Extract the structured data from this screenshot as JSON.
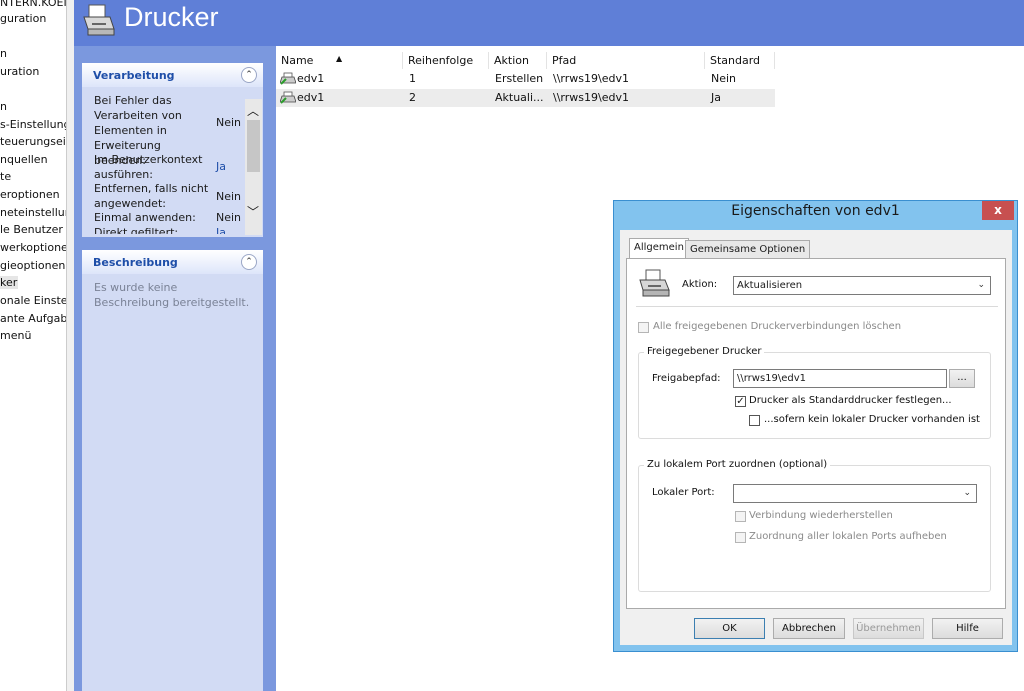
{
  "tree": {
    "items": [
      {
        "label": "NTERN.KOEN"
      },
      {
        "label": "guration"
      },
      {
        "label": "n"
      },
      {
        "label": "uration"
      },
      {
        "label": "n"
      },
      {
        "label": "s-Einstellung"
      },
      {
        "label": "teuerungseir"
      },
      {
        "label": "nquellen"
      },
      {
        "label": "te"
      },
      {
        "label": "eroptionen"
      },
      {
        "label": "neteinstellur"
      },
      {
        "label": "le Benutzer u"
      },
      {
        "label": "werkoptione"
      },
      {
        "label": "gieoptionen"
      },
      {
        "label": "ker"
      },
      {
        "label": "onale Einstel"
      },
      {
        "label": "ante Aufgab"
      },
      {
        "label": "menü"
      }
    ]
  },
  "header": {
    "title": "Drucker",
    "icon": "printer-icon"
  },
  "panels": {
    "verarbeitung": {
      "title": "Verarbeitung",
      "rows": [
        {
          "key": "Bei Fehler das Verarbeiten von Elementen in Erweiterung beenden:",
          "value": "Nein"
        },
        {
          "key": "Im Benutzerkontext ausführen:",
          "value": "Ja"
        },
        {
          "key": "Entfernen, falls nicht angewendet:",
          "value": "Nein"
        },
        {
          "key": "Einmal anwenden:",
          "value": "Nein"
        },
        {
          "key": "Direkt gefiltert:",
          "value": "Ja"
        }
      ]
    },
    "beschreibung": {
      "title": "Beschreibung",
      "text": "Es wurde keine Beschreibung bereitgestellt."
    }
  },
  "table": {
    "columns": [
      "Name",
      "Reihenfolge",
      "Aktion",
      "Pfad",
      "Standard"
    ],
    "rows": [
      {
        "name": "edv1",
        "order": "1",
        "action": "Erstellen",
        "path": "\\\\rrws19\\edv1",
        "default": "Nein"
      },
      {
        "name": "edv1",
        "order": "2",
        "action": "Aktuali...",
        "path": "\\\\rrws19\\edv1",
        "default": "Ja"
      }
    ]
  },
  "dialog": {
    "title": "Eigenschaften von edv1",
    "close": "x",
    "tabs": [
      "Allgemein",
      "Gemeinsame Optionen"
    ],
    "action_label": "Aktion:",
    "action_value": "Aktualisieren",
    "delete_all": "Alle freigegebenen Druckerverbindungen löschen",
    "shared_group": "Freigegebener Drucker",
    "share_path_label": "Freigabepfad:",
    "share_path_value": "\\\\rrws19\\edv1",
    "browse": "...",
    "set_default": "Drucker als Standarddrucker festlegen...",
    "if_no_local": "...sofern kein lokaler Drucker vorhanden ist",
    "port_group": "Zu lokalem Port zuordnen (optional)",
    "local_port_label": "Lokaler Port:",
    "local_port_value": "",
    "reconnect": "Verbindung wiederherstellen",
    "unmap_all": "Zuordnung aller lokalen Ports aufheben",
    "buttons": {
      "ok": "OK",
      "cancel": "Abbrechen",
      "apply": "Übernehmen",
      "help": "Hilfe"
    }
  }
}
